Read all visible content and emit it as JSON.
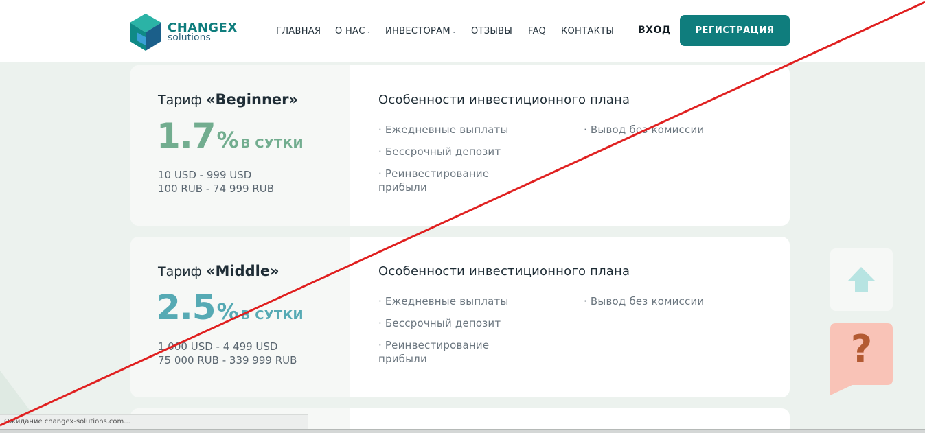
{
  "header": {
    "brand_name": "CHANGEX",
    "brand_sub": "solutions",
    "nav": [
      {
        "label": "ГЛАВНАЯ",
        "dropdown": false
      },
      {
        "label": "О НАС",
        "dropdown": true
      },
      {
        "label": "ИНВЕСТОРАМ",
        "dropdown": true
      },
      {
        "label": "ОТЗЫВЫ",
        "dropdown": false
      },
      {
        "label": "FAQ",
        "dropdown": false
      },
      {
        "label": "КОНТАКТЫ",
        "dropdown": false
      }
    ],
    "login_label": "ВХОД",
    "register_label": "РЕГИСТРАЦИЯ"
  },
  "plans": [
    {
      "title_prefix": "Тариф",
      "name": "«Beginner»",
      "rate": "1.7",
      "rate_pct": "%",
      "rate_unit": "в сутки",
      "range_usd": "10 USD - 999 USD",
      "range_rub": "100 RUB - 74 999 RUB",
      "features_title": "Особенности инвестиционного плана",
      "features_left": [
        "· Ежедневные выплаты",
        "· Бессрочный депозит",
        "· Реинвестирование\nприбыли"
      ],
      "features_right": [
        "· Вывод без комиссии"
      ],
      "accent": "#72ad8f"
    },
    {
      "title_prefix": "Тариф",
      "name": "«Middle»",
      "rate": "2.5",
      "rate_pct": "%",
      "rate_unit": "в сутки",
      "range_usd": "1 000 USD - 4 499 USD",
      "range_rub": "75 000 RUB - 339 999 RUB",
      "features_title": "Особенности инвестиционного плана",
      "features_left": [
        "· Ежедневные выплаты",
        "· Бессрочный депозит",
        "· Реинвестирование\nприбыли"
      ],
      "features_right": [
        "· Вывод без комиссии"
      ],
      "accent": "#56aab4"
    }
  ],
  "widgets": {
    "up_icon": "arrow-up-icon",
    "help_icon": "question-icon",
    "help_label": "?"
  },
  "status_bar": {
    "text": "Ожидание changex-solutions.com..."
  }
}
